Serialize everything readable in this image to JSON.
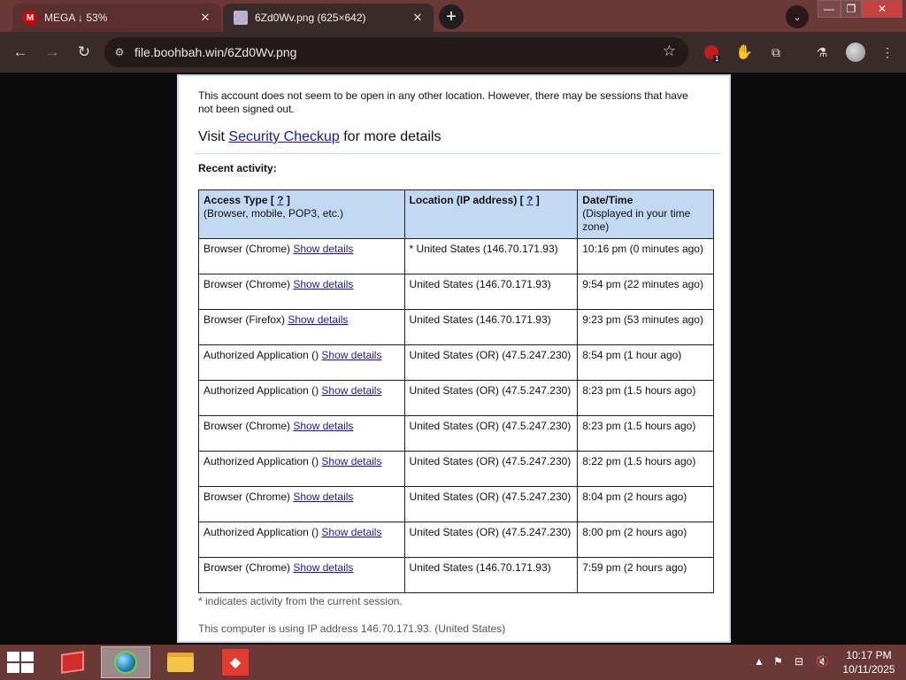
{
  "browser": {
    "tabs": [
      {
        "title": "MEGA ↓ 53%",
        "favicon": "mega-icon",
        "active": false
      },
      {
        "title": "6Zd0Wv.png (625×642)",
        "favicon": "image-icon",
        "active": true
      }
    ],
    "new_tab_glyph": "+",
    "url": "file.boohbah.win/6Zd0Wv.png",
    "extension_badge": "1"
  },
  "page": {
    "notice": "This account does not seem to be open in any other location. However, there may be sessions that have not been signed out.",
    "visit_prefix": "Visit ",
    "visit_link": "Security Checkup",
    "visit_suffix": " for more details",
    "recent_label": "Recent activity:",
    "table": {
      "headers": [
        {
          "title": "Access Type",
          "help": "?",
          "sub": "(Browser, mobile, POP3, etc.)"
        },
        {
          "title": "Location (IP address)",
          "help": "?",
          "sub": ""
        },
        {
          "title": "Date/Time",
          "help": "",
          "sub": "(Displayed in your time zone)"
        }
      ],
      "link_label": "Show details",
      "rows": [
        {
          "type": "Browser (Chrome)",
          "location": "* United States (146.70.171.93)",
          "time": "10:16 pm (0 minutes ago)"
        },
        {
          "type": "Browser (Chrome)",
          "location": "United States (146.70.171.93)",
          "time": "9:54 pm (22 minutes ago)"
        },
        {
          "type": "Browser (Firefox)",
          "location": "United States (146.70.171.93)",
          "time": "9:23 pm (53 minutes ago)"
        },
        {
          "type": "Authorized Application ()",
          "location": "United States (OR) (47.5.247.230)",
          "time": "8:54 pm (1 hour ago)"
        },
        {
          "type": "Authorized Application ()",
          "location": "United States (OR) (47.5.247.230)",
          "time": "8:23 pm (1.5 hours ago)"
        },
        {
          "type": "Browser (Chrome)",
          "location": "United States (OR) (47.5.247.230)",
          "time": "8:23 pm (1.5 hours ago)"
        },
        {
          "type": "Authorized Application ()",
          "location": "United States (OR) (47.5.247.230)",
          "time": "8:22 pm (1.5 hours ago)"
        },
        {
          "type": "Browser (Chrome)",
          "location": "United States (OR) (47.5.247.230)",
          "time": "8:04 pm (2 hours ago)"
        },
        {
          "type": "Authorized Application ()",
          "location": "United States (OR) (47.5.247.230)",
          "time": "8:00 pm (2 hours ago)"
        },
        {
          "type": "Browser (Chrome)",
          "location": "United States (146.70.171.93)",
          "time": "7:59 pm (2 hours ago)"
        }
      ]
    },
    "footnote": "* indicates activity from the current session.",
    "ip_note": "This computer is using IP address 146.70.171.93. (United States)"
  },
  "taskbar": {
    "time": "10:17 PM",
    "date": "10/11/2025"
  }
}
